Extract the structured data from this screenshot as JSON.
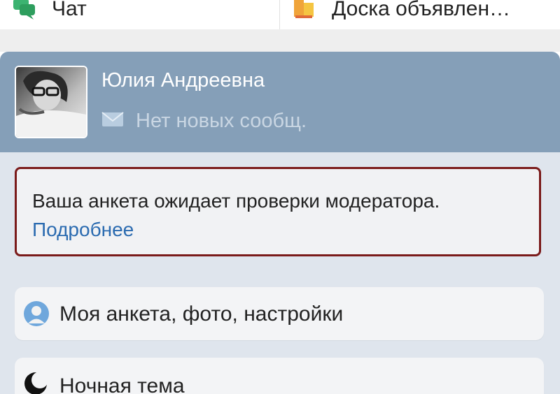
{
  "topbar": {
    "tabs": [
      {
        "label": "Чат",
        "icon": "chat-bubbles-icon"
      },
      {
        "label": "Доска объявлен…",
        "icon": "bulletin-board-icon"
      }
    ]
  },
  "profile": {
    "name": "Юлия Андреевна",
    "messages_label": "Нет новых сообщ.",
    "avatar": "avatar-photo",
    "envelope_icon": "envelope-icon"
  },
  "notice": {
    "text": "Ваша анкета ожидает проверки модератора.",
    "link": "Подробнее"
  },
  "menu": {
    "items": [
      {
        "label": "Моя анкета, фото, настройки",
        "icon": "user-profile-icon"
      },
      {
        "label": "Ночная тема",
        "icon": "moon-icon"
      }
    ]
  },
  "colors": {
    "profile_bg": "#859fb8",
    "page_bg": "#dfe5ed",
    "notice_border": "#7a1a1a",
    "link": "#2b6bb0"
  }
}
